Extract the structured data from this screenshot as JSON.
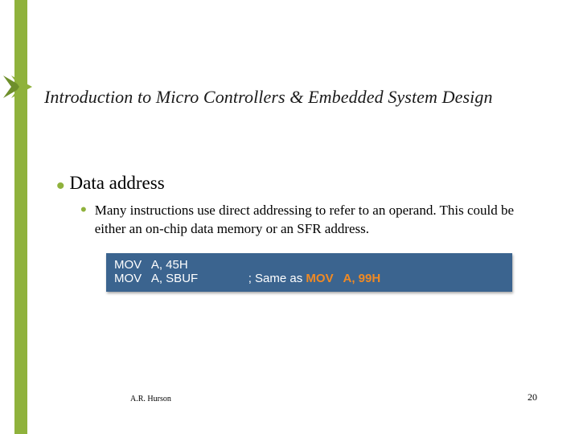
{
  "title": "Introduction to Micro Controllers & Embedded System Design",
  "bullet_main": "Data address",
  "bullet_sub": "Many instructions use direct addressing to refer to an operand.  This could be either an on-chip data memory or an SFR address.",
  "code": {
    "line1_a": "MOV   A, 45H",
    "line2_a": "MOV   A, SBUF",
    "line2_comment_pre": "; Same as ",
    "line2_comment_orange": "MOV   A, 99H"
  },
  "footer": {
    "author": "A.R. Hurson",
    "page": "20"
  },
  "colors": {
    "accent": "#8fb23c",
    "codebox": "#3b648f",
    "orange": "#f08a24"
  }
}
